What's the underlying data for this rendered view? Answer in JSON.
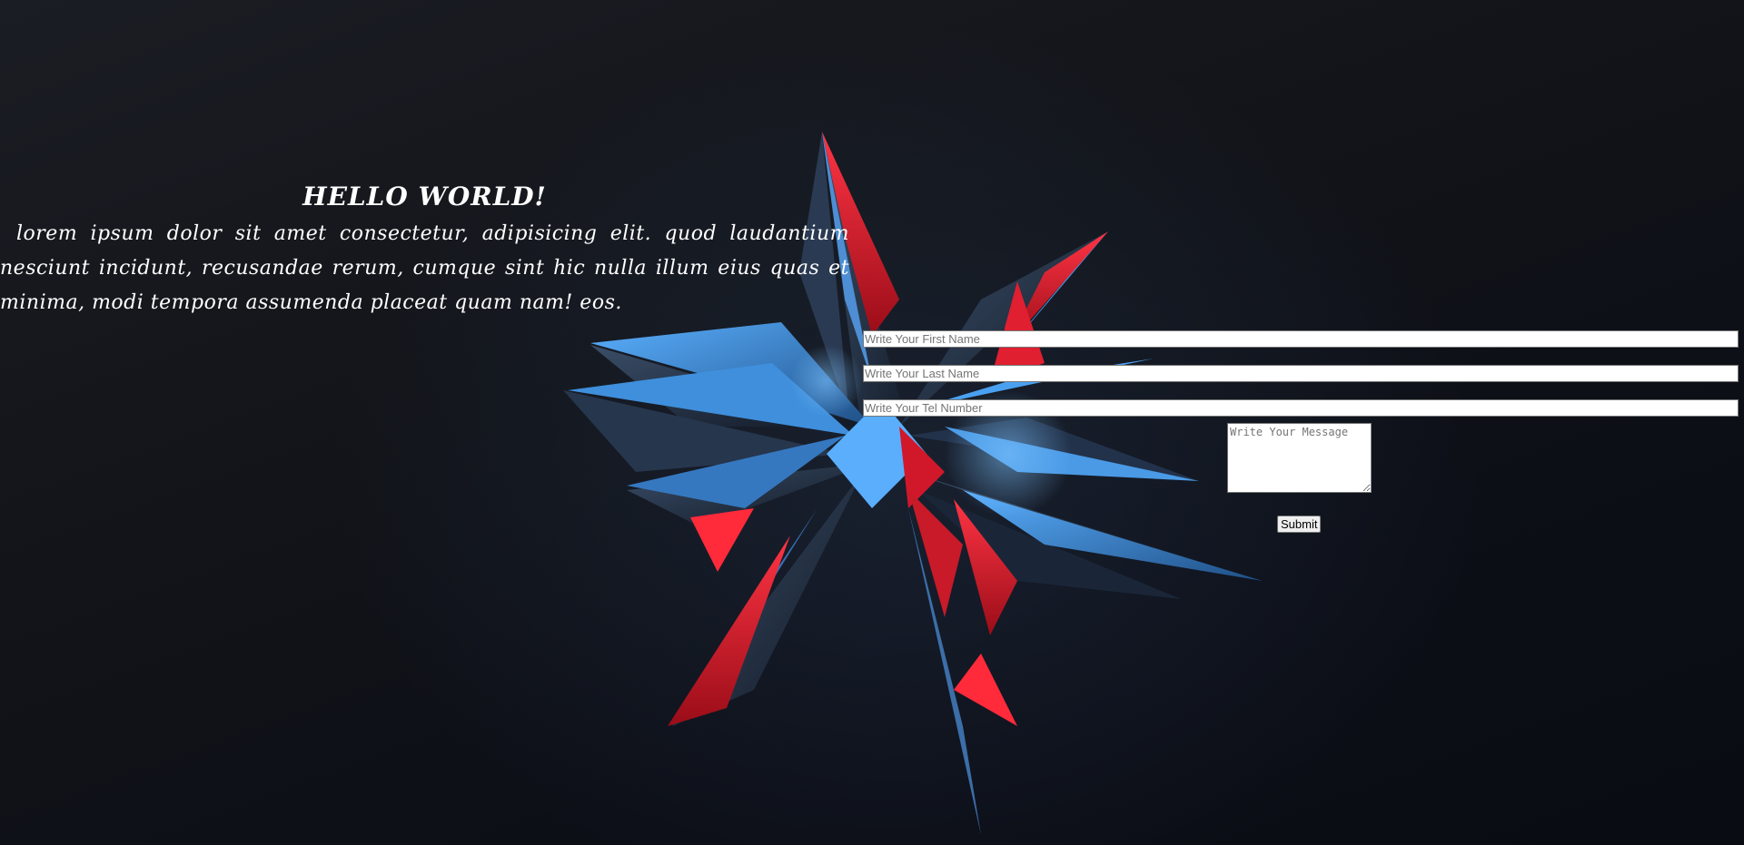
{
  "hero": {
    "title": "HELLO WORLD!",
    "body": "lorem ipsum dolor sit amet consectetur, adipisicing elit. quod laudantium nesciunt incidunt, recusandae rerum, cumque sint hic nulla illum eius quas et minima, modi tempora assumenda placeat quam nam! eos."
  },
  "form": {
    "first_name_placeholder": "Write Your First Name",
    "last_name_placeholder": "Write Your Last Name",
    "tel_placeholder": "Write Your Tel Number",
    "message_placeholder": "Write Your Message",
    "submit_label": "Submit"
  },
  "colors": {
    "background": "#121419",
    "shard_blue": "#3d8fe0",
    "shard_red": "#ff2a3a",
    "shard_dark": "#1c2a3c"
  }
}
